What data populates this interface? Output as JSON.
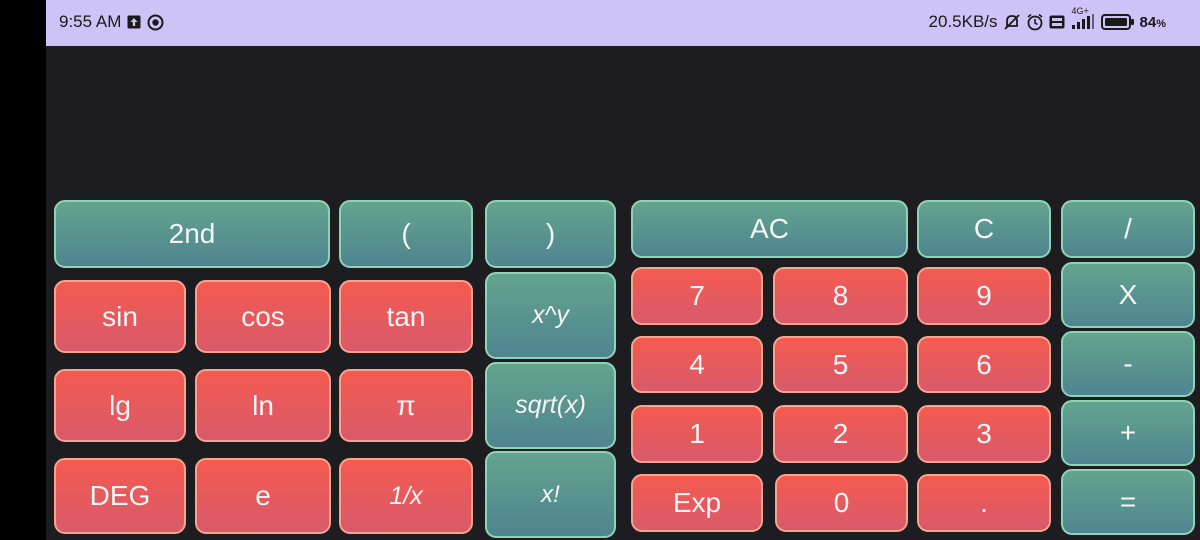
{
  "status": {
    "time": "9:55 AM",
    "speed": "20.5KB/s",
    "network": "4G+",
    "battery": "84",
    "battery_unit": "%"
  },
  "keys": {
    "second": "2nd",
    "paren_open": "(",
    "paren_close": ")",
    "ac": "AC",
    "clear": "C",
    "divide": "/",
    "sin": "sin",
    "cos": "cos",
    "tan": "tan",
    "power": "x^y",
    "seven": "7",
    "eight": "8",
    "nine": "9",
    "multiply": "X",
    "lg": "lg",
    "ln": "ln",
    "pi": "π",
    "sqrt": "sqrt(x)",
    "four": "4",
    "five": "5",
    "six": "6",
    "minus": "-",
    "one": "1",
    "two": "2",
    "three": "3",
    "plus": "+",
    "deg": "DEG",
    "e": "e",
    "reciprocal": "1/x",
    "factorial": "x!",
    "exp": "Exp",
    "zero": "0",
    "dot": ".",
    "equals": "="
  }
}
